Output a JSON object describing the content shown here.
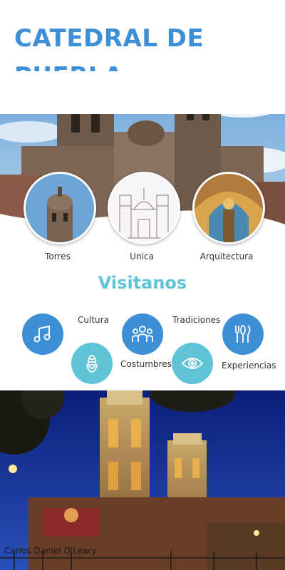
{
  "title": {
    "line1": "CATEDRAL DE",
    "line2": "PUEBLA"
  },
  "colors": {
    "primary_blue": "#3d8fd6",
    "teal": "#5ec4d6",
    "text": "#333333"
  },
  "gallery": [
    {
      "label": "Torres",
      "icon": "tower-photo"
    },
    {
      "label": "Unica",
      "icon": "facade-drawing"
    },
    {
      "label": "Arquitectura",
      "icon": "dome-interior-photo"
    }
  ],
  "section_title": "Visitanos",
  "features": [
    {
      "label": "Cultura",
      "icon": "music-note-icon"
    },
    {
      "label": "Costumbres",
      "icon": "corn-icon"
    },
    {
      "label": "Tradiciones",
      "icon": "people-group-icon"
    },
    {
      "label": "",
      "icon": "eye-icon"
    },
    {
      "label": "Experiencias",
      "icon": "utensils-icon"
    }
  ],
  "extra_label": "Experiencias",
  "photo_credit": "Carlos Daniel O'Leary"
}
